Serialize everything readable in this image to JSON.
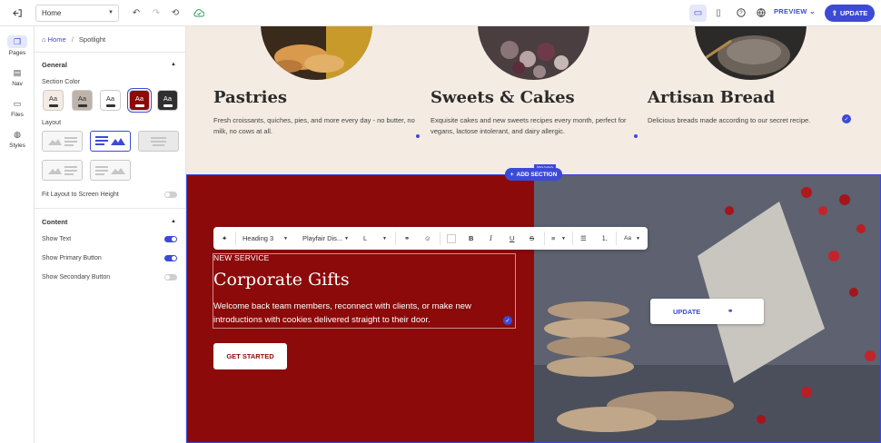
{
  "topbar": {
    "page_select": "Home",
    "preview_label": "PREVIEW",
    "update_label": "UPDATE"
  },
  "leftnav": {
    "items": [
      {
        "label": "Pages",
        "icon": "pages-icon"
      },
      {
        "label": "Nav",
        "icon": "nav-icon"
      },
      {
        "label": "Files",
        "icon": "folder-icon"
      },
      {
        "label": "Styles",
        "icon": "palette-icon"
      }
    ]
  },
  "panel": {
    "breadcrumb_home": "Home",
    "breadcrumb_sep": "/",
    "breadcrumb_current": "Spotlight",
    "general_title": "General",
    "section_color_label": "Section Color",
    "swatch_text": "Aa",
    "layout_label": "Layout",
    "fit_layout_label": "Fit Layout to Screen Height",
    "content_title": "Content",
    "show_text_label": "Show Text",
    "show_primary_label": "Show Primary Button",
    "show_secondary_label": "Show Secondary Button"
  },
  "cards": [
    {
      "title": "Pastries",
      "text": "Fresh croissants, quiches, pies, and more every day - no butter, no milk, no cows at all."
    },
    {
      "title": "Sweets & Cakes",
      "text": "Exquisite cakes and new sweets recipes every month, perfect for vegans, lactose intolerant, and dairy allergic."
    },
    {
      "title": "Artisan Bread",
      "text": "Delicious breads made according to our secret recipe."
    }
  ],
  "add_section_label": "ADD SECTION",
  "image_tag": "Image",
  "toolbar": {
    "heading": "Heading 3",
    "font": "Playfair Dis...",
    "size": "L",
    "text_case": "Aa"
  },
  "hero": {
    "kicker": "NEW SERVICE",
    "title": "Corporate Gifts",
    "text": "Welcome back team members, reconnect with clients, or make new introductions with cookies delivered straight to their door.",
    "primary_button": "GET STARTED",
    "image_button": "UPDATE"
  },
  "colors": {
    "accent": "#3d4ad6",
    "hero_red": "#8c0a0a",
    "cards_bg": "#f4ebe2"
  }
}
